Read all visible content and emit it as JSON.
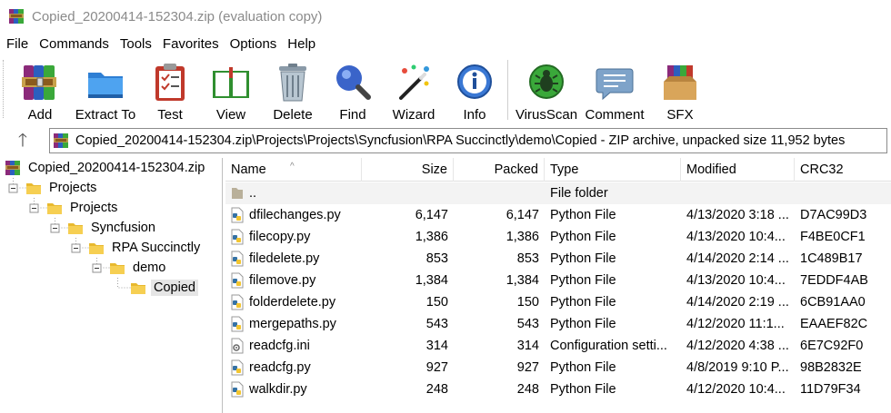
{
  "window": {
    "title": "Copied_20200414-152304.zip (evaluation copy)"
  },
  "menu": [
    "File",
    "Commands",
    "Tools",
    "Favorites",
    "Options",
    "Help"
  ],
  "toolbar": {
    "add": "Add",
    "extract": "Extract To",
    "test": "Test",
    "view": "View",
    "delete": "Delete",
    "find": "Find",
    "wizard": "Wizard",
    "info": "Info",
    "virusscan": "VirusScan",
    "comment": "Comment",
    "sfx": "SFX"
  },
  "address": {
    "up_glyph": "🡑",
    "path": "Copied_20200414-152304.zip\\Projects\\Projects\\Syncfusion\\RPA Succinctly\\demo\\Copied - ZIP archive, unpacked size 11,952 bytes"
  },
  "tree": {
    "root": "Copied_20200414-152304.zip",
    "nodes": [
      "Projects",
      "Projects",
      "Syncfusion",
      "RPA Succinctly",
      "demo",
      "Copied"
    ]
  },
  "columns": {
    "name": "Name",
    "size": "Size",
    "packed": "Packed",
    "type": "Type",
    "modified": "Modified",
    "crc": "CRC32"
  },
  "parent_row": {
    "name": "..",
    "type": "File folder"
  },
  "files": [
    {
      "name": "dfilechanges.py",
      "size": "6,147",
      "packed": "6,147",
      "type": "Python File",
      "modified": "4/13/2020 3:18 ...",
      "crc": "D7AC99D3",
      "icon": "python-file-icon"
    },
    {
      "name": "filecopy.py",
      "size": "1,386",
      "packed": "1,386",
      "type": "Python File",
      "modified": "4/13/2020 10:4...",
      "crc": "F4BE0CF1",
      "icon": "python-file-icon"
    },
    {
      "name": "filedelete.py",
      "size": "853",
      "packed": "853",
      "type": "Python File",
      "modified": "4/14/2020 2:14 ...",
      "crc": "1C489B17",
      "icon": "python-file-icon"
    },
    {
      "name": "filemove.py",
      "size": "1,384",
      "packed": "1,384",
      "type": "Python File",
      "modified": "4/13/2020 10:4...",
      "crc": "7EDDF4AB",
      "icon": "python-file-icon"
    },
    {
      "name": "folderdelete.py",
      "size": "150",
      "packed": "150",
      "type": "Python File",
      "modified": "4/14/2020 2:19 ...",
      "crc": "6CB91AA0",
      "icon": "python-file-icon"
    },
    {
      "name": "mergepaths.py",
      "size": "543",
      "packed": "543",
      "type": "Python File",
      "modified": "4/12/2020 11:1...",
      "crc": "EAAEF82C",
      "icon": "python-file-icon"
    },
    {
      "name": "readcfg.ini",
      "size": "314",
      "packed": "314",
      "type": "Configuration setti...",
      "modified": "4/12/2020 4:38 ...",
      "crc": "6E7C92F0",
      "icon": "config-file-icon"
    },
    {
      "name": "readcfg.py",
      "size": "927",
      "packed": "927",
      "type": "Python File",
      "modified": "4/8/2019 9:10 P...",
      "crc": "98B2832E",
      "icon": "python-file-icon"
    },
    {
      "name": "walkdir.py",
      "size": "248",
      "packed": "248",
      "type": "Python File",
      "modified": "4/12/2020 10:4...",
      "crc": "11D79F34",
      "icon": "python-file-icon"
    }
  ]
}
